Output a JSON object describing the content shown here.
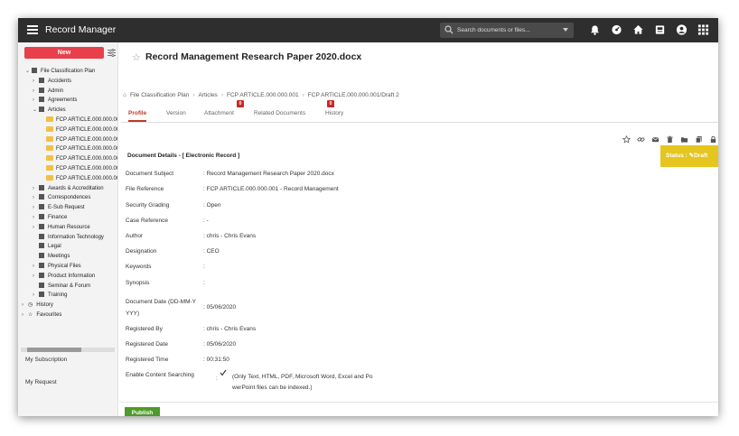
{
  "app": {
    "title": "Record Manager"
  },
  "search": {
    "placeholder": "Search documents or files..."
  },
  "sidebar": {
    "new_label": "New",
    "tree": [
      {
        "label": "File Classification Plan",
        "level": 0,
        "kind": "root",
        "expand": "open"
      },
      {
        "label": "Accidents",
        "level": 1,
        "kind": "node",
        "expand": "closed"
      },
      {
        "label": "Admin",
        "level": 1,
        "kind": "node",
        "expand": "closed"
      },
      {
        "label": "Agreements",
        "level": 1,
        "kind": "node",
        "expand": "closed"
      },
      {
        "label": "Articles",
        "level": 1,
        "kind": "node",
        "expand": "open"
      },
      {
        "label": "FCP ARTICLE.000.000.00",
        "level": 2,
        "kind": "folder",
        "expand": "none"
      },
      {
        "label": "FCP ARTICLE.000.000.00",
        "level": 2,
        "kind": "folder",
        "expand": "none"
      },
      {
        "label": "FCP ARTICLE.000.000.00",
        "level": 2,
        "kind": "folder",
        "expand": "none"
      },
      {
        "label": "FCP ARTICLE.000.000.00",
        "level": 2,
        "kind": "folder",
        "expand": "none"
      },
      {
        "label": "FCP ARTICLE.000.000.00",
        "level": 2,
        "kind": "folder",
        "expand": "none"
      },
      {
        "label": "FCP ARTICLE.000.000.00",
        "level": 2,
        "kind": "folder",
        "expand": "none"
      },
      {
        "label": "FCP ARTICLE.000.000.00",
        "level": 2,
        "kind": "folder",
        "expand": "none"
      },
      {
        "label": "Awards & Accreditation",
        "level": 1,
        "kind": "node",
        "expand": "closed"
      },
      {
        "label": "Correspondences",
        "level": 1,
        "kind": "node",
        "expand": "closed"
      },
      {
        "label": "E-Sub Request",
        "level": 1,
        "kind": "node",
        "expand": "closed"
      },
      {
        "label": "Finance",
        "level": 1,
        "kind": "node",
        "expand": "closed"
      },
      {
        "label": "Human Resource",
        "level": 1,
        "kind": "node",
        "expand": "closed"
      },
      {
        "label": "Information Technology",
        "level": 1,
        "kind": "node",
        "expand": "none"
      },
      {
        "label": "Legal",
        "level": 1,
        "kind": "node",
        "expand": "none"
      },
      {
        "label": "Meetings",
        "level": 1,
        "kind": "node",
        "expand": "none"
      },
      {
        "label": "Physical Files",
        "level": 1,
        "kind": "node",
        "expand": "closed"
      },
      {
        "label": "Product Information",
        "level": 1,
        "kind": "node",
        "expand": "closed"
      },
      {
        "label": "Seminar & Forum",
        "level": 1,
        "kind": "node",
        "expand": "none"
      },
      {
        "label": "Training",
        "level": 1,
        "kind": "node",
        "expand": "closed"
      },
      {
        "label": "History",
        "level": 0,
        "kind": "history",
        "expand": "closed"
      },
      {
        "label": "Favourites",
        "level": 0,
        "kind": "favourite",
        "expand": "closed"
      }
    ],
    "links": [
      "My Subscription",
      "My Request"
    ]
  },
  "document": {
    "title": "Record Management Research Paper 2020.docx"
  },
  "breadcrumb": [
    "File Classification Plan",
    "Articles",
    "FCP ARTICLE.000.000.001",
    "FCP ARTICLE.000.000.001/Draft 2"
  ],
  "tabs": [
    {
      "label": "Profile",
      "active": true
    },
    {
      "label": "Version",
      "active": false
    },
    {
      "label": "Attachment",
      "active": false,
      "badge": "0"
    },
    {
      "label": "Related Documents",
      "active": false,
      "badge": "0"
    },
    {
      "label": "History",
      "active": false
    }
  ],
  "toolbar_icons": [
    "star-icon",
    "link-icon",
    "mail-icon",
    "trash-icon",
    "folder-icon",
    "copy-icon",
    "lock-icon",
    "edit-icon"
  ],
  "status": {
    "label": "Status :",
    "value": "Draft",
    "color": "#e5c51f"
  },
  "details": {
    "section_title": "Document Details - [ Electronic Record ]",
    "fields": [
      {
        "label": "Document Subject",
        "value": ": Record Management Research Paper 2020.docx"
      },
      {
        "label": "File Reference",
        "value": ": FCP ARTICLE.000.000.001 - Record Management"
      },
      {
        "label": "Security Grading",
        "value": ": Open"
      },
      {
        "label": "Case Reference",
        "value": ": -"
      },
      {
        "label": "Author",
        "value": ": chris - Chris Evans"
      },
      {
        "label": "Designation",
        "value": ": CEO"
      },
      {
        "label": "Keywords",
        "value": ":"
      },
      {
        "label": "Synopsis",
        "value": ":"
      },
      {
        "label": "Document Date (DD-MM-Y",
        "label2": "YYY)",
        "value": ": 05/06/2020"
      },
      {
        "label": "Registered By",
        "value": ": chris - Chris Evans"
      },
      {
        "label": "Registered Date",
        "value": ": 05/06/2020"
      },
      {
        "label": "Registered Time",
        "value": ": 00:31:50"
      },
      {
        "label": "Enable Content Searching",
        "value": ":"
      }
    ],
    "content_search_hint_1": "(Only Text, HTML, PDF, Microsoft Word, Excel and Po",
    "content_search_hint_2": "werPoint files can be indexed.)"
  },
  "publish_label": "Publish",
  "colors": {
    "topbar": "#2e2e2e",
    "new_button": "#e8404a",
    "publish": "#4e9a2a",
    "active_tab": "#c0392b"
  }
}
